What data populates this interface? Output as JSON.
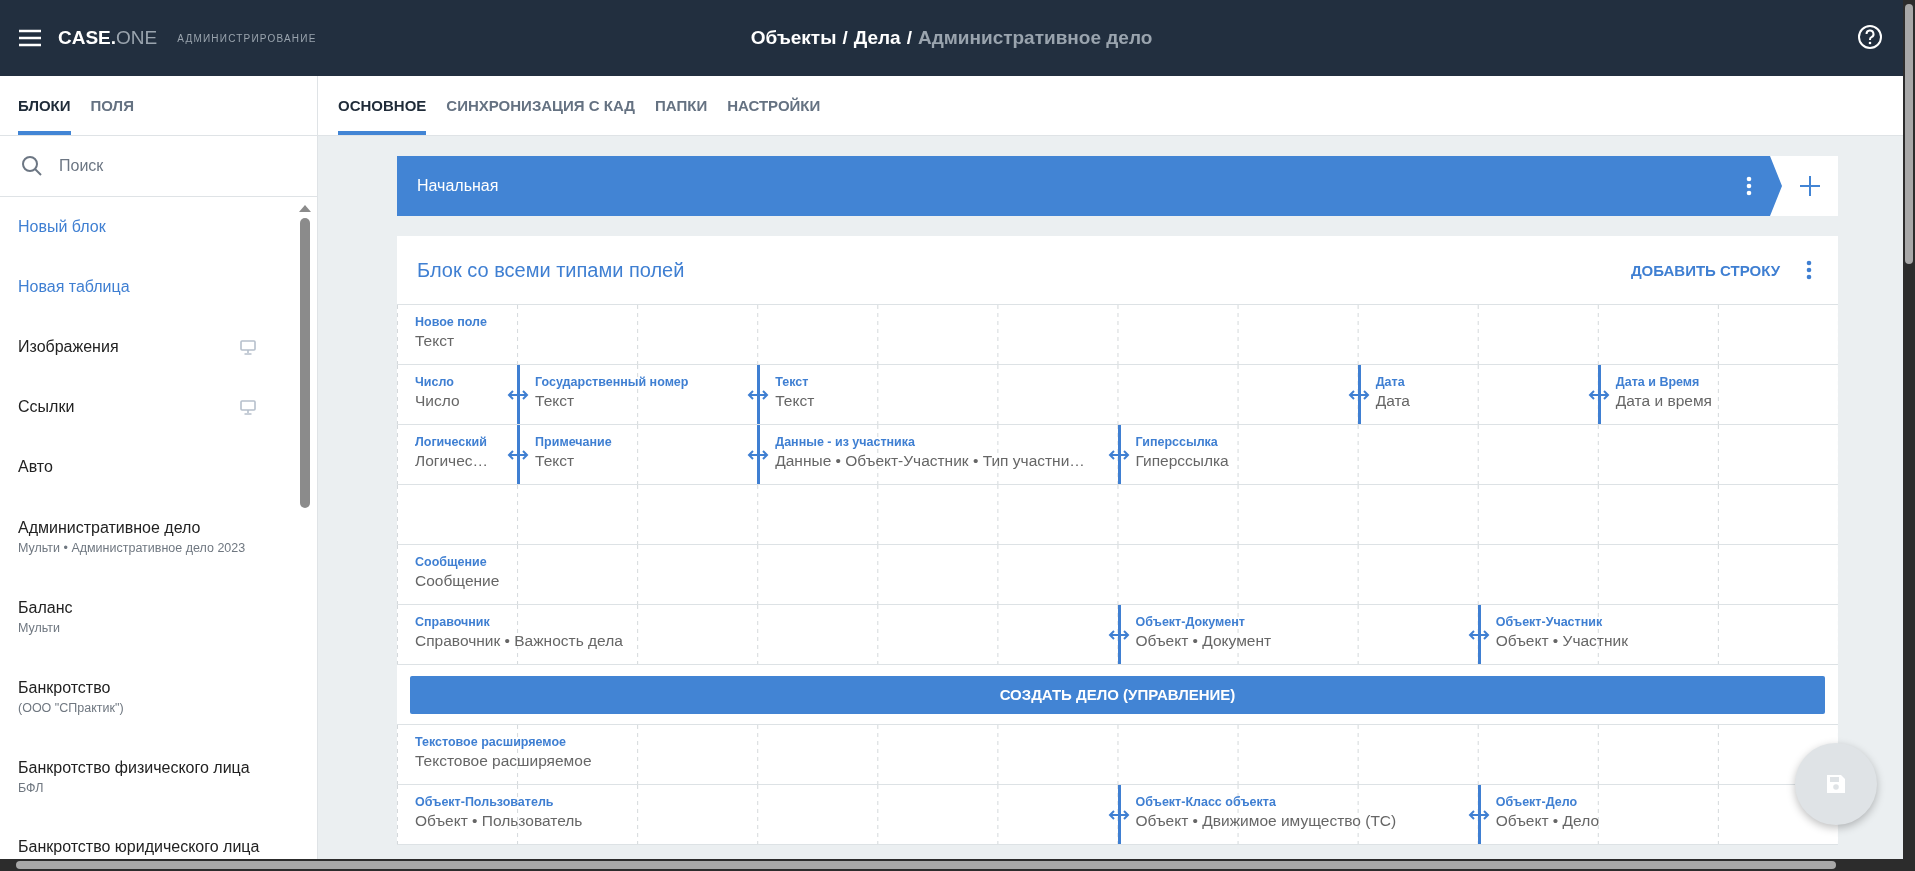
{
  "header": {
    "logo": {
      "primary": "CASE.",
      "secondary": "ONE"
    },
    "subtitle": "АДМИНИСТРИРОВАНИЕ",
    "breadcrumb": [
      {
        "kind": "crumb",
        "text": "Объекты",
        "current": false
      },
      {
        "kind": "separator",
        "text": "/"
      },
      {
        "kind": "crumb",
        "text": "Дела",
        "current": false
      },
      {
        "kind": "separator",
        "text": "/"
      },
      {
        "kind": "crumb",
        "text": "Административное дело",
        "current": true
      }
    ]
  },
  "sidebar": {
    "tabs": [
      {
        "label": "БЛОКИ",
        "selected": true
      },
      {
        "label": "ПОЛЯ",
        "selected": false
      }
    ],
    "search": {
      "placeholder": "Поиск"
    },
    "items": [
      {
        "kind": "action",
        "title": "Новый блок"
      },
      {
        "kind": "action",
        "title": "Новая таблица"
      },
      {
        "kind": "block",
        "title": "Изображения",
        "device_icon": true
      },
      {
        "kind": "block",
        "title": "Ссылки",
        "device_icon": true
      },
      {
        "kind": "block",
        "title": "Авто",
        "device_icon": false
      },
      {
        "kind": "block",
        "title": "Административное дело",
        "subtitle": "Мульти • Административное дело 2023",
        "device_icon": false
      },
      {
        "kind": "block",
        "title": "Баланс",
        "subtitle": "Мульти",
        "device_icon": false
      },
      {
        "kind": "block",
        "title": "Банкротство",
        "subtitle": "(ООО \"СПрактик\")",
        "device_icon": false
      },
      {
        "kind": "block",
        "title": "Банкротство физического лица",
        "subtitle": "БФЛ",
        "device_icon": false
      },
      {
        "kind": "block",
        "title": "Банкротство юридического лица"
      }
    ]
  },
  "tabs": [
    {
      "label": "ОСНОВНОЕ",
      "selected": true
    },
    {
      "label": "СИНХРОНИЗАЦИЯ С КАД",
      "selected": false
    },
    {
      "label": "ПАПКИ",
      "selected": false
    },
    {
      "label": "НАСТРОЙКИ",
      "selected": false
    }
  ],
  "page_bar": {
    "title": "Начальная"
  },
  "block": {
    "title": "Блок со всеми типами полей",
    "add_row": "ДОБАВИТЬ СТРОКУ",
    "rows": [
      {
        "kind": "fields",
        "cells": [
          {
            "label": "Новое поле",
            "value": "Текст"
          }
        ]
      },
      {
        "kind": "fields",
        "cells": [
          {
            "label": "Число",
            "value": "Число"
          },
          {
            "label": "Государственный номер",
            "value": "Текст"
          },
          {
            "label": "Текст",
            "value": "Текст"
          },
          {
            "label": "Дата",
            "value": "Дата"
          },
          {
            "label": "Дата и Время",
            "value": "Дата и время"
          }
        ]
      },
      {
        "kind": "fields",
        "cells": [
          {
            "label": "Логический",
            "value": "Логичес…"
          },
          {
            "label": "Примечание",
            "value": "Текст"
          },
          {
            "label": "Данные - из участника",
            "value": "Данные • Объект-Участник • Тип участни…"
          },
          {
            "label": "Гиперссылка",
            "value": "Гиперссылка"
          }
        ]
      },
      {
        "kind": "empty"
      },
      {
        "kind": "fields",
        "cells": [
          {
            "label": "Сообщение",
            "value": "Сообщение"
          }
        ]
      },
      {
        "kind": "fields",
        "cells": [
          {
            "label": "Справочник",
            "value": "Справочник • Важность дела"
          },
          {
            "label": "Объект-Документ",
            "value": "Объект • Документ"
          },
          {
            "label": "Объект-Участник",
            "value": "Объект • Участник"
          }
        ]
      },
      {
        "kind": "button",
        "label": "СОЗДАТЬ ДЕЛО (УПРАВЛЕНИЕ)"
      },
      {
        "kind": "fields",
        "cells": [
          {
            "label": "Текстовое расширяемое",
            "value": "Текстовое расширяемое"
          }
        ]
      },
      {
        "kind": "fields",
        "cells": [
          {
            "label": "Объект-Пользователь",
            "value": "Объект • Пользователь"
          },
          {
            "label": "Объект-Класс объекта",
            "value": "Объект • Движимое имущество (ТС)"
          },
          {
            "label": "Объект-Дело",
            "value": "Объект • Дело"
          }
        ]
      }
    ]
  }
}
